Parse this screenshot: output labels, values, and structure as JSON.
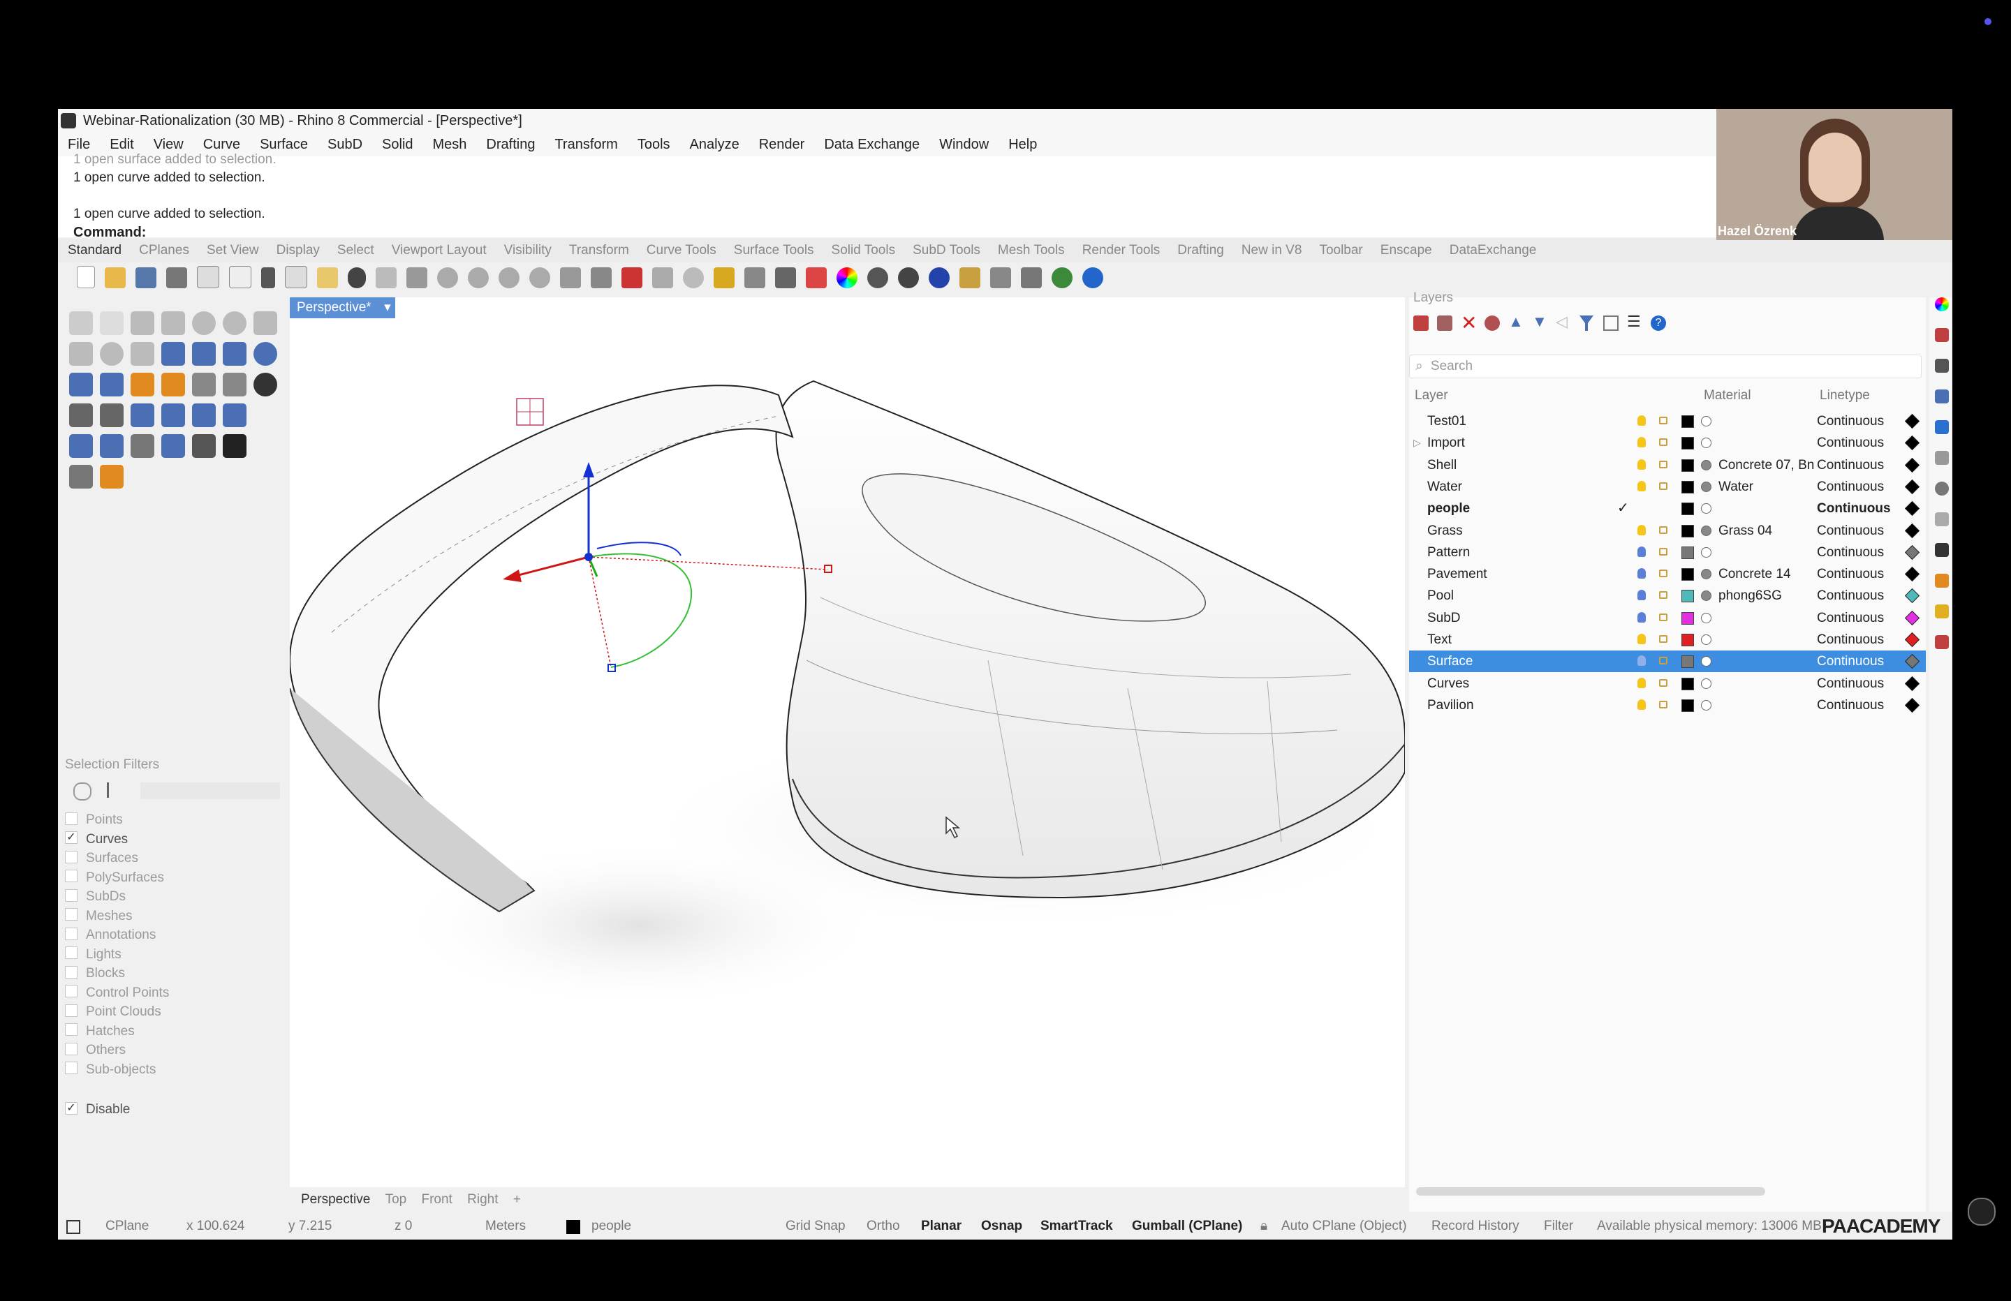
{
  "window": {
    "title": "Webinar-Rationalization (30 MB) - Rhino 8 Commercial - [Perspective*]"
  },
  "menu": [
    "File",
    "Edit",
    "View",
    "Curve",
    "Surface",
    "SubD",
    "Solid",
    "Mesh",
    "Drafting",
    "Transform",
    "Tools",
    "Analyze",
    "Render",
    "Data Exchange",
    "Window",
    "Help"
  ],
  "command_history": {
    "line1": "1 open surface added to selection.",
    "line2": "1 open curve added to selection.",
    "line3": "1 open curve added to selection.",
    "prompt": "Command:"
  },
  "toolbar_tabs": [
    "Standard",
    "CPlanes",
    "Set View",
    "Display",
    "Select",
    "Viewport Layout",
    "Visibility",
    "Transform",
    "Curve Tools",
    "Surface Tools",
    "Solid Tools",
    "SubD Tools",
    "Mesh Tools",
    "Render Tools",
    "Drafting",
    "New in V8",
    "Toolbar",
    "Enscape",
    "DataExchange"
  ],
  "active_toolbar_tab": "Standard",
  "viewport": {
    "active_tab": "Perspective*",
    "bottom_tabs": [
      "Perspective",
      "Top",
      "Front",
      "Right"
    ],
    "add_tab_glyph": "+"
  },
  "selection_filters": {
    "header": "Selection Filters",
    "items": [
      {
        "label": "Points",
        "checked": false
      },
      {
        "label": "Curves",
        "checked": true
      },
      {
        "label": "Surfaces",
        "checked": false
      },
      {
        "label": "PolySurfaces",
        "checked": false
      },
      {
        "label": "SubDs",
        "checked": false
      },
      {
        "label": "Meshes",
        "checked": false
      },
      {
        "label": "Annotations",
        "checked": false
      },
      {
        "label": "Lights",
        "checked": false
      },
      {
        "label": "Blocks",
        "checked": false
      },
      {
        "label": "Control Points",
        "checked": false
      },
      {
        "label": "Point Clouds",
        "checked": false
      },
      {
        "label": "Hatches",
        "checked": false
      },
      {
        "label": "Others",
        "checked": false
      },
      {
        "label": "Sub-objects",
        "checked": false
      }
    ],
    "disable": {
      "label": "Disable",
      "checked": true
    }
  },
  "layers_panel": {
    "title": "Layers",
    "search_placeholder": "Search",
    "columns": {
      "layer": "Layer",
      "material": "Material",
      "linetype": "Linetype"
    },
    "rows": [
      {
        "name": "Test01",
        "color": "#000000",
        "material": "",
        "linetype": "Continuous",
        "selected": false,
        "current": false,
        "bulb": "#f5c518",
        "expand": ""
      },
      {
        "name": "Import",
        "color": "#000000",
        "material": "",
        "linetype": "Continuous",
        "selected": false,
        "current": false,
        "bulb": "#f5c518",
        "expand": "▷"
      },
      {
        "name": "Shell",
        "color": "#000000",
        "material": "Concrete 07, Bn",
        "linetype": "Continuous",
        "selected": false,
        "current": false,
        "bulb": "#f5c518",
        "expand": ""
      },
      {
        "name": "Water",
        "color": "#000000",
        "material": "Water",
        "linetype": "Continuous",
        "selected": false,
        "current": false,
        "bulb": "#f5c518",
        "expand": ""
      },
      {
        "name": "people",
        "color": "#000000",
        "material": "",
        "linetype": "Continuous",
        "selected": false,
        "current": true,
        "bulb": "",
        "expand": ""
      },
      {
        "name": "Grass",
        "color": "#000000",
        "material": "Grass 04",
        "linetype": "Continuous",
        "selected": false,
        "current": false,
        "bulb": "#f5c518",
        "expand": ""
      },
      {
        "name": "Pattern",
        "color": "#777777",
        "material": "",
        "linetype": "Continuous",
        "selected": false,
        "current": false,
        "bulb": "#5a7fd6",
        "expand": ""
      },
      {
        "name": "Pavement",
        "color": "#000000",
        "material": "Concrete 14",
        "linetype": "Continuous",
        "selected": false,
        "current": false,
        "bulb": "#5a7fd6",
        "expand": ""
      },
      {
        "name": "Pool",
        "color": "#4fb8b8",
        "material": "phong6SG",
        "linetype": "Continuous",
        "selected": false,
        "current": false,
        "bulb": "#5a7fd6",
        "expand": ""
      },
      {
        "name": "SubD",
        "color": "#e030e0",
        "material": "",
        "linetype": "Continuous",
        "selected": false,
        "current": false,
        "bulb": "#5a7fd6",
        "expand": ""
      },
      {
        "name": "Text",
        "color": "#e02020",
        "material": "",
        "linetype": "Continuous",
        "selected": false,
        "current": false,
        "bulb": "#f5c518",
        "expand": ""
      },
      {
        "name": "Surface",
        "color": "#777777",
        "material": "",
        "linetype": "Continuous",
        "selected": true,
        "current": false,
        "bulb": "#8fb0e8",
        "expand": ""
      },
      {
        "name": "Curves",
        "color": "#000000",
        "material": "",
        "linetype": "Continuous",
        "selected": false,
        "current": false,
        "bulb": "#f5c518",
        "expand": ""
      },
      {
        "name": "Pavilion",
        "color": "#000000",
        "material": "",
        "linetype": "Continuous",
        "selected": false,
        "current": false,
        "bulb": "#f5c518",
        "expand": ""
      }
    ]
  },
  "statusbar": {
    "cplane": "CPlane",
    "x": "x 100.624",
    "y": "y 7.215",
    "z": "z 0",
    "units": "Meters",
    "layer": "people",
    "grid_snap": "Grid Snap",
    "ortho": "Ortho",
    "planar": "Planar",
    "osnap": "Osnap",
    "smarttrack": "SmartTrack",
    "gumball": "Gumball (CPlane)",
    "auto_cplane": "Auto CPlane (Object)",
    "record_history": "Record History",
    "filter": "Filter",
    "memory": "Available physical memory: 13006 MB"
  },
  "webcam": {
    "name": "Hazel Özrenk"
  },
  "watermark": "PAACADEMY",
  "colors": {
    "accent": "#3d8ee0",
    "viewport_tab": "#5b8fd6",
    "background": "#000000"
  }
}
